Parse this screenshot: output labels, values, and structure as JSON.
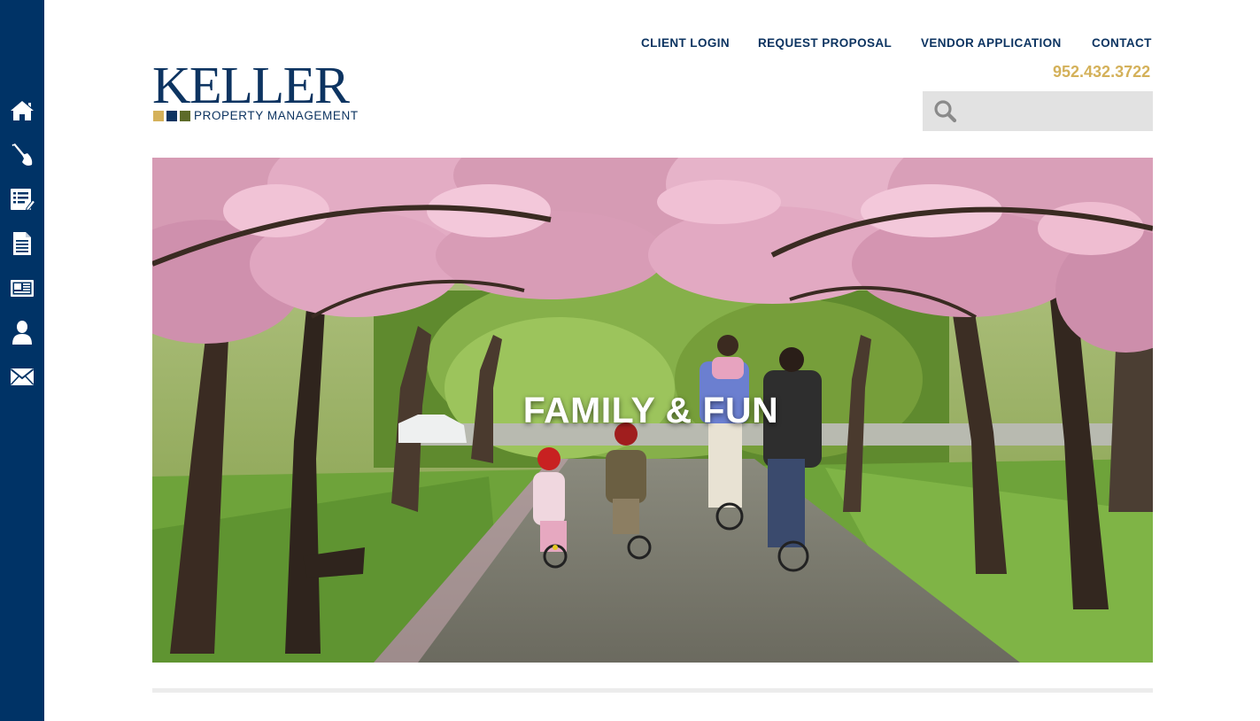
{
  "sidebar": {
    "items": [
      {
        "icon": "home-icon",
        "label": "Home"
      },
      {
        "icon": "shovel-icon",
        "label": "Services"
      },
      {
        "icon": "form-edit-icon",
        "label": "Forms"
      },
      {
        "icon": "document-icon",
        "label": "Documents"
      },
      {
        "icon": "newspaper-icon",
        "label": "News"
      },
      {
        "icon": "person-icon",
        "label": "About"
      },
      {
        "icon": "envelope-icon",
        "label": "Contact"
      }
    ],
    "background": "#003366"
  },
  "nav": {
    "client_login": "CLIENT LOGIN",
    "request_proposal": "REQUEST PROPOSAL",
    "vendor_application": "VENDOR APPLICATION",
    "contact": "CONTACT"
  },
  "phone": "952.432.3722",
  "search": {
    "placeholder": "",
    "value": "",
    "icon": "search-icon"
  },
  "logo": {
    "word": "KELLER",
    "subtitle": "PROPERTY MANAGEMENT",
    "square_colors": [
      "#d4b15a",
      "#0d3461",
      "#5d6b2a"
    ]
  },
  "hero": {
    "title": "FAMILY & FUN"
  },
  "colors": {
    "brand_navy": "#0d3461",
    "accent_gold": "#d4b15a",
    "search_bg": "#e2e2e2"
  }
}
